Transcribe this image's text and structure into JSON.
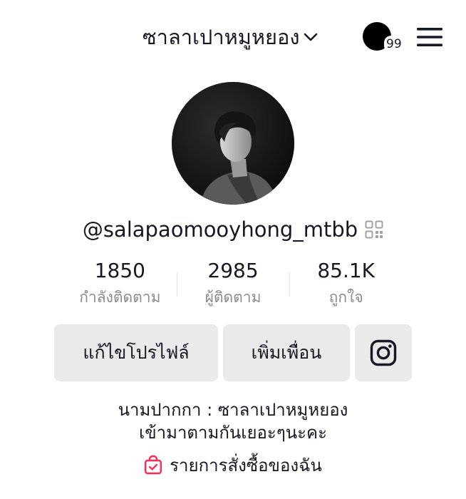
{
  "header": {
    "title": "ซาลาเปาหมูหยอง",
    "notification_count": "99"
  },
  "profile": {
    "username": "@salapaomooyhong_mtbb"
  },
  "stats": [
    {
      "value": "1850",
      "label": "กำลังติดตาม"
    },
    {
      "value": "2985",
      "label": "ผู้ติดตาม"
    },
    {
      "value": "85.1K",
      "label": "ถูกใจ"
    }
  ],
  "buttons": {
    "edit_profile": "แก้ไขโปรไฟล์",
    "add_friends": "เพิ่มเพื่อน"
  },
  "bio": {
    "line1": "นามปากกา : ซาลาเปาหมูหยอง",
    "line2": "เข้ามาตามกันเยอะๆนะคะ"
  },
  "orders_label": "รายการสั่งซื้อของฉัน",
  "colors": {
    "text": "#161823",
    "muted": "#8a8b91",
    "button_bg": "#eaeaea",
    "bag_icon": "#fe2c55"
  }
}
